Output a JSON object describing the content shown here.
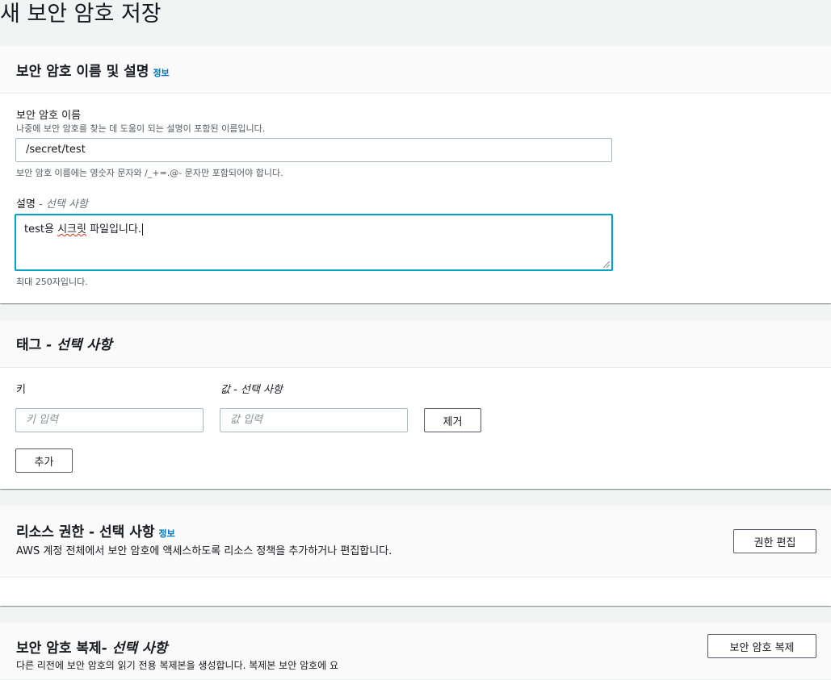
{
  "page": {
    "title": "새 보안 암호 저장"
  },
  "secret_panel": {
    "title": "보안 암호 이름 및 설명",
    "info": "정보",
    "name_label": "보안 암호 이름",
    "name_hint": "나중에 보안 암호를 찾는 데 도움이 되는 설명이 포함된 이름입니다.",
    "name_value": "/secret/test",
    "name_constraint": "보안 암호 이름에는 영숫자 문자와 /_+=.@- 문자만 포함되어야 합니다.",
    "desc_label": "설명",
    "desc_optional": "- 선택 사항",
    "desc_value_prefix": "test용 ",
    "desc_value_misspelled": "시크릿",
    "desc_value_suffix": " 파일입니다.",
    "desc_limit": "최대 250자입니다."
  },
  "tags_panel": {
    "title": "태그",
    "title_optional": "- 선택 사항",
    "key_label": "키",
    "value_label": "값 - 선택 사항",
    "key_placeholder": "키 입력",
    "value_placeholder": "값 입력",
    "remove_button": "제거",
    "add_button": "추가"
  },
  "permissions_panel": {
    "title": "리소스 권한 - 선택 사항",
    "info": "정보",
    "description": "AWS 계정 전체에서 보안 암호에 액세스하도록 리소스 정책을 추가하거나 편집합니다.",
    "edit_button": "권한 편집"
  },
  "replication_panel": {
    "title": "보안 암호 복제-",
    "title_optional": "선택 사항",
    "description": "다른 리전에 보안 암호의 읽기 전용 복제본을 생성합니다. 복제본 보안 암호에 요",
    "replicate_button": "보안 암호 복제"
  },
  "colors": {
    "accent": "#00a1c9",
    "link": "#0073bb",
    "background": "#f2f3f3"
  }
}
